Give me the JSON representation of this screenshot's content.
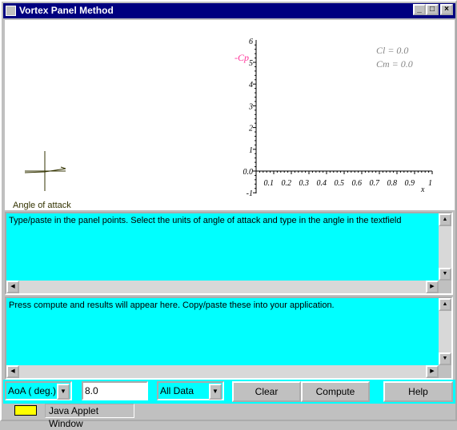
{
  "window": {
    "title": "Vortex Panel Method",
    "minimize": "_",
    "maximize": "□",
    "close": "×"
  },
  "plot": {
    "y_ticks": [
      "6",
      "5",
      "4",
      "3",
      "2",
      "1",
      "0.0",
      "-1"
    ],
    "x_ticks": [
      "0.1",
      "0.2",
      "0.3",
      "0.4",
      "0.5",
      "0.6",
      "0.7",
      "0.8",
      "0.9",
      "1"
    ],
    "xlabel": "x",
    "ylabel": "-Cp",
    "cl_text": "Cl = 0.0",
    "cm_text": "Cm = 0.0",
    "ylabel_color": "#ff3399"
  },
  "angle_label": "Angle of attack",
  "input_area": {
    "text": "Type/paste in the panel points. Select the units of angle of attack and type in the angle in the textfield"
  },
  "output_area": {
    "text": "Press compute and results will appear here. Copy/paste these into your application."
  },
  "controls": {
    "units_select": "AoA ( deg.)",
    "angle_value": "8.0",
    "output_select": "All Data",
    "clear": "Clear",
    "compute": "Compute",
    "help": "Help"
  },
  "status": {
    "text": "Java Applet Window"
  },
  "colors": {
    "title_bar": "#000080",
    "textarea": "#00ffff"
  }
}
